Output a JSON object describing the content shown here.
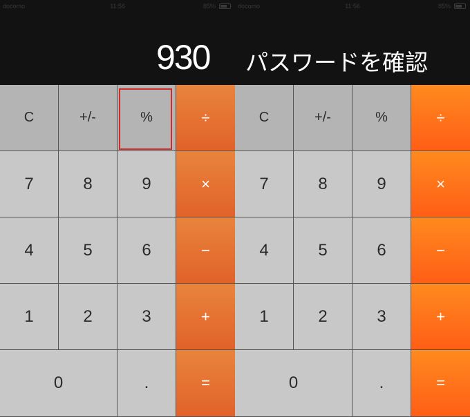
{
  "status_bar": {
    "carrier": "docomo",
    "time": "11:56",
    "battery": "85%"
  },
  "display": {
    "number": "930"
  },
  "caption": "パスワードを確認",
  "keys": [
    {
      "label": "C",
      "kind": "fn"
    },
    {
      "label": "+/-",
      "kind": "fn"
    },
    {
      "label": "%",
      "kind": "fn"
    },
    {
      "label": "÷",
      "kind": "op"
    },
    {
      "label": "7",
      "kind": "digit"
    },
    {
      "label": "8",
      "kind": "digit"
    },
    {
      "label": "9",
      "kind": "digit"
    },
    {
      "label": "×",
      "kind": "op"
    },
    {
      "label": "4",
      "kind": "digit"
    },
    {
      "label": "5",
      "kind": "digit"
    },
    {
      "label": "6",
      "kind": "digit"
    },
    {
      "label": "−",
      "kind": "op"
    },
    {
      "label": "1",
      "kind": "digit"
    },
    {
      "label": "2",
      "kind": "digit"
    },
    {
      "label": "3",
      "kind": "digit"
    },
    {
      "label": "+",
      "kind": "op"
    },
    {
      "label": "0",
      "kind": "zero"
    },
    {
      "label": ".",
      "kind": "digit"
    },
    {
      "label": "=",
      "kind": "op"
    }
  ],
  "colors": {
    "operator_left": "#e57332",
    "operator_right": "#ff7518",
    "function_key": "#b4b4b4",
    "digit_key": "#c8c8c8",
    "highlight_border": "#d22b2b"
  }
}
